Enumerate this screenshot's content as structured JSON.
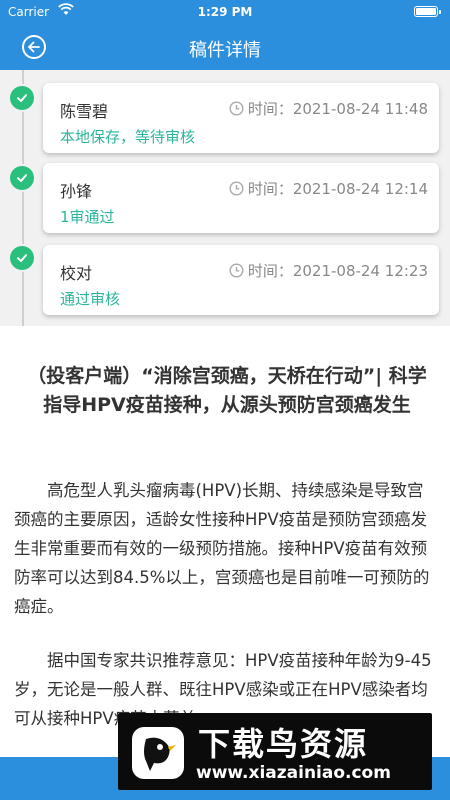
{
  "status_bar": {
    "carrier": "Carrier",
    "time": "1:29 PM"
  },
  "header": {
    "title": "稿件详情"
  },
  "timeline": [
    {
      "name": "陈雪碧",
      "time": "时间：2021-08-24 11:48",
      "status": "本地保存，等待审核"
    },
    {
      "name": "孙锋",
      "time": "时间：2021-08-24 12:14",
      "status": "1审通过"
    },
    {
      "name": "校对",
      "time": "时间：2021-08-24 12:23",
      "status": "通过审核"
    }
  ],
  "article": {
    "title": "（投客户端）“消除宫颈癌，天桥在行动”| 科学指导HPV疫苗接种，从源头预防宫颈癌发生",
    "paragraphs": [
      "高危型人乳头瘤病毒(HPV)长期、持续感染是导致宫颈癌的主要原因，适龄女性接种HPV疫苗是预防宫颈癌发生非常重要而有效的一级预防措施。接种HPV疫苗有效预防率可以达到84.5%以上，宫颈癌也是目前唯一可预防的癌症。",
      "据中国专家共识推荐意见：HPV疫苗接种年龄为9-45岁，无论是一般人群、既往HPV感染或正在HPV感染者均可从接种HPV疫苗中获益"
    ]
  },
  "watermark": {
    "big": "下载鸟资源",
    "small": "www.xiazainiao.com"
  },
  "colors": {
    "header": "#2c8fdd",
    "check": "#2bbf7e",
    "status_text": "#2bb59a"
  }
}
